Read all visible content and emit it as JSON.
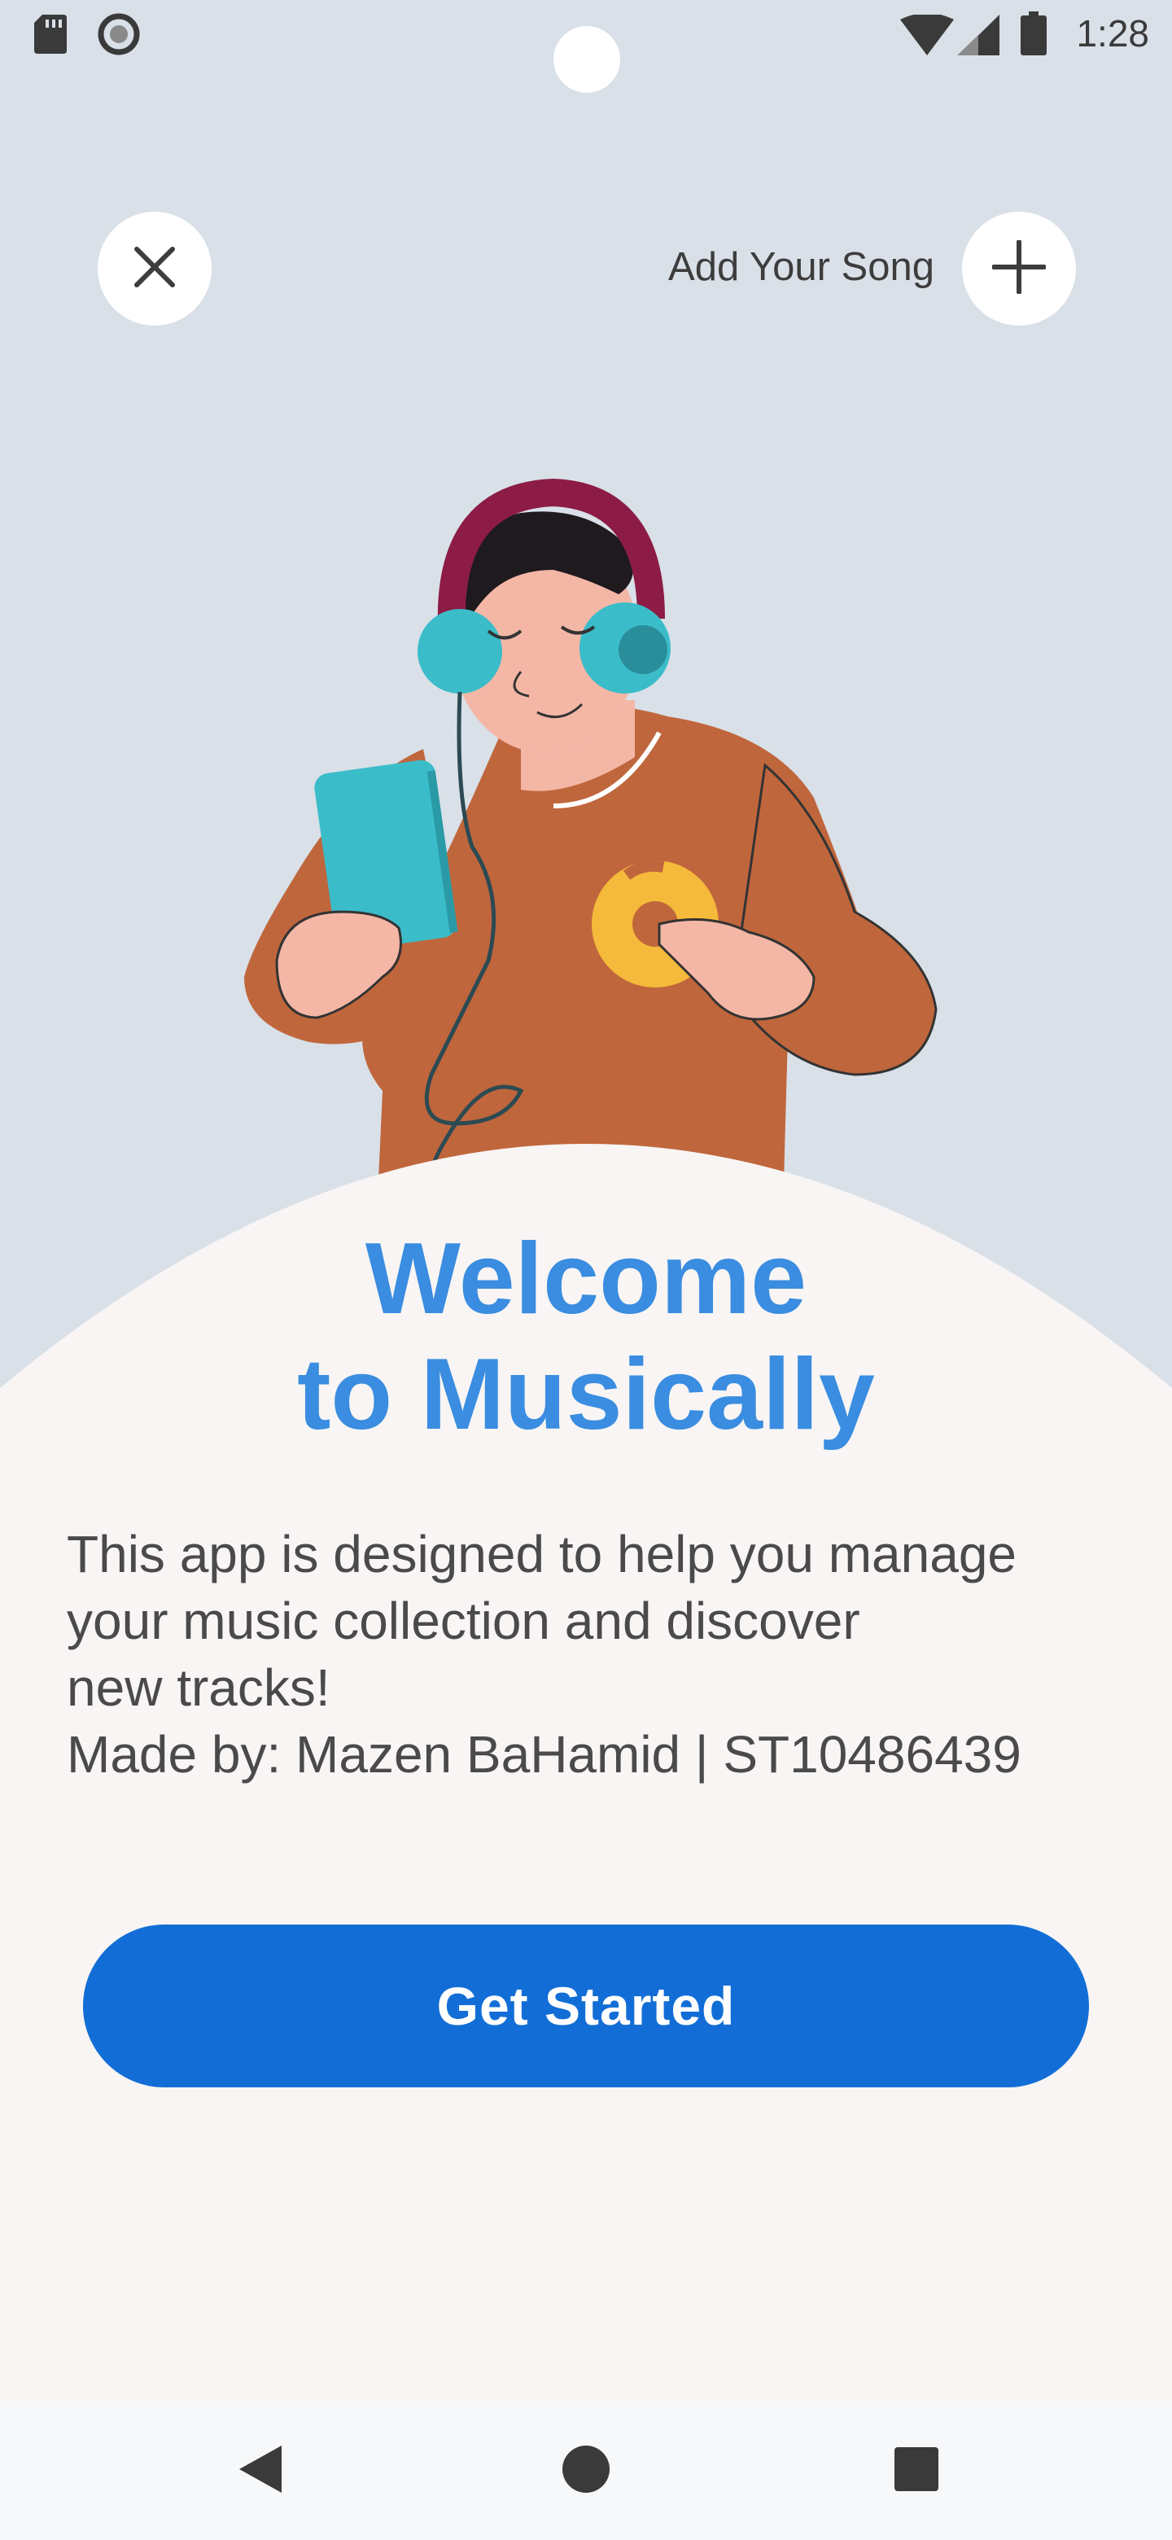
{
  "status_bar": {
    "time": "1:28",
    "icons": [
      "sd-card-icon",
      "circle-notification-icon",
      "wifi-icon",
      "cellular-signal-icon",
      "battery-icon"
    ]
  },
  "header": {
    "close_icon": "close-icon",
    "add_label": "Add Your Song",
    "add_icon": "plus-icon"
  },
  "illustration": {
    "description_icon": "person-with-headphones-illustration"
  },
  "welcome": {
    "title_line1": "Welcome",
    "title_line2": "to Musically",
    "description_lines": [
      "This app is designed to help you manage",
      "your music collection and discover",
      "new tracks!",
      "Made by: Mazen BaHamid | ST10486439"
    ]
  },
  "actions": {
    "get_started_label": "Get Started"
  },
  "nav": {
    "icons": [
      "back-icon",
      "home-icon",
      "recents-icon"
    ]
  },
  "colors": {
    "background": "#d9e0e8",
    "card": "#f8f5f4",
    "title": "#3a8de0",
    "button": "#126ed6"
  }
}
